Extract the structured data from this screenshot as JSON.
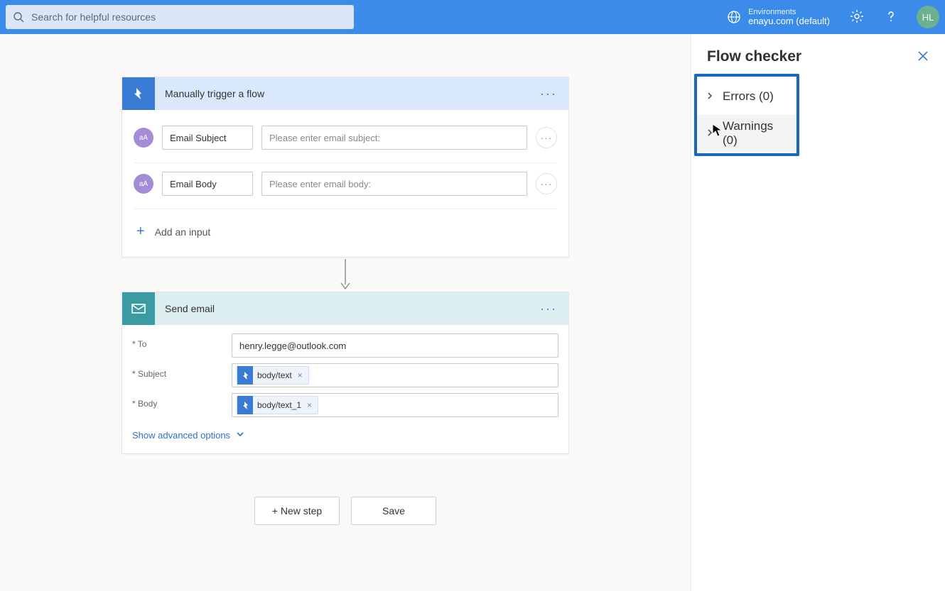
{
  "topbar": {
    "search_placeholder": "Search for helpful resources",
    "env_label": "Environments",
    "env_value": "enayu.com (default)",
    "avatar": "HL"
  },
  "trigger": {
    "title": "Manually trigger a flow",
    "param_badge": "aA",
    "rows": [
      {
        "label": "Email Subject",
        "placeholder": "Please enter email subject:"
      },
      {
        "label": "Email Body",
        "placeholder": "Please enter email body:"
      }
    ],
    "add_input": "Add an input"
  },
  "sendEmail": {
    "title": "Send email",
    "fields": {
      "to_label": "* To",
      "to_value": "henry.legge@outlook.com",
      "subject_label": "* Subject",
      "subject_token": "body/text",
      "body_label": "* Body",
      "body_token": "body/text_1"
    },
    "advanced": "Show advanced options"
  },
  "actions": {
    "new_step": "+ New step",
    "save": "Save"
  },
  "panel": {
    "title": "Flow checker",
    "errors": "Errors (0)",
    "warnings": "Warnings (0)"
  }
}
